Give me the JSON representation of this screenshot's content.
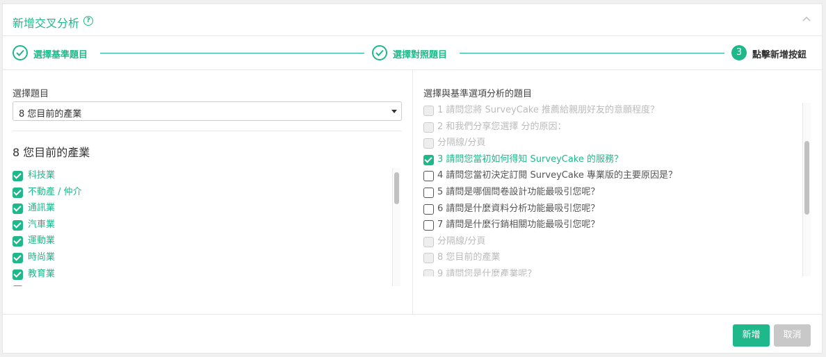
{
  "header": {
    "title": "新增交叉分析",
    "help_icon": "help-circle-icon",
    "collapse_icon": "chevron-up-icon"
  },
  "steps": [
    {
      "label": "選擇基準題目",
      "state": "done"
    },
    {
      "label": "選擇對照題目",
      "state": "done"
    },
    {
      "label": "點擊新增按鈕",
      "state": "active",
      "number": "3"
    }
  ],
  "left": {
    "field_label": "選擇題目",
    "select_value": "8 您目前的產業",
    "question_title": "8 您目前的產業",
    "options": [
      {
        "label": "科技業",
        "checked": true
      },
      {
        "label": "不動產 / 仲介",
        "checked": true
      },
      {
        "label": "通訊業",
        "checked": true
      },
      {
        "label": "汽車業",
        "checked": true
      },
      {
        "label": "運動業",
        "checked": true
      },
      {
        "label": "時尚業",
        "checked": true
      },
      {
        "label": "教育業",
        "checked": true
      },
      {
        "label": "",
        "checked": true
      }
    ]
  },
  "right": {
    "field_label": "選擇與基準選項分析的題目",
    "questions": [
      {
        "label": "1 請問您將 SurveyCake 推薦給親朋好友的意願程度？",
        "state": "disabled"
      },
      {
        "label": "2 和我們分享您選擇 分的原因：",
        "state": "disabled"
      },
      {
        "label": "分隔線/分頁",
        "state": "disabled"
      },
      {
        "label": "3 請問您當初如何得知 SurveyCake 的服務？",
        "state": "checked"
      },
      {
        "label": "4 請問您當初決定訂閱 SurveyCake 專業版的主要原因是？",
        "state": "unchecked"
      },
      {
        "label": "5 請問是哪個問卷設計功能最吸引您呢？",
        "state": "unchecked"
      },
      {
        "label": "6 請問是什麼資料分析功能最吸引您呢？",
        "state": "unchecked"
      },
      {
        "label": "7 請問是什麼行銷相關功能最吸引您呢？",
        "state": "unchecked"
      },
      {
        "label": "分隔線/分頁",
        "state": "disabled"
      },
      {
        "label": "8 您目前的產業",
        "state": "disabled"
      },
      {
        "label": "9 請問您是什麼產業呢？",
        "state": "disabled"
      }
    ]
  },
  "footer": {
    "add_label": "新增",
    "cancel_label": "取消"
  },
  "colors": {
    "accent": "#1fb88a",
    "disabled_button": "#c8c8c8"
  }
}
